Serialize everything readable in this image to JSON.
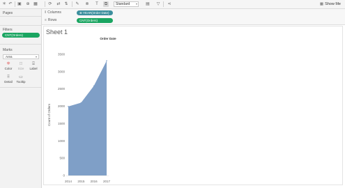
{
  "toolbar": {
    "format_select": "Standard",
    "show_me_label": "Show Me"
  },
  "left_panel": {
    "pages_title": "Pages",
    "filters_title": "Filters",
    "filter_pill": "CNT(Orders)",
    "marks_title": "Marks",
    "mark_type": "Area",
    "mark_buttons": [
      "Color",
      "Size",
      "Label",
      "Detail",
      "Tooltip"
    ]
  },
  "shelves": {
    "columns_label": "Columns",
    "columns_pill": "YEAR(Order Date)",
    "rows_label": "Rows",
    "rows_pill": "CNT(Orders)"
  },
  "sheet": {
    "title": "Sheet 1"
  },
  "chart_data": {
    "type": "area",
    "title": "Order Date",
    "categories": [
      "2014",
      "2015",
      "2016",
      "2017"
    ],
    "values": [
      1993,
      2102,
      2587,
      3312
    ],
    "ylabel": "Count of Orders",
    "y_ticks": [
      0,
      500,
      1000,
      1500,
      2000,
      2500,
      3000,
      3500
    ],
    "ylim": [
      0,
      3500
    ],
    "fill_color": "#7f9fc7",
    "grid": false
  },
  "colors": {
    "accent_green": "#1aa561",
    "accent_teal": "#3c8f9e"
  }
}
